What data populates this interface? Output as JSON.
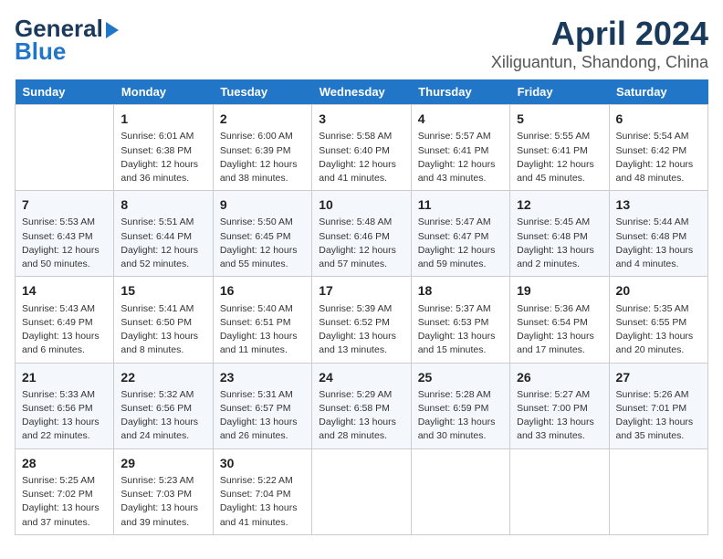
{
  "header": {
    "logo_line1": "General",
    "logo_line2": "Blue",
    "title": "April 2024",
    "subtitle": "Xiliguantun, Shandong, China"
  },
  "days_of_week": [
    "Sunday",
    "Monday",
    "Tuesday",
    "Wednesday",
    "Thursday",
    "Friday",
    "Saturday"
  ],
  "weeks": [
    [
      {
        "day": "",
        "content": ""
      },
      {
        "day": "1",
        "content": "Sunrise: 6:01 AM\nSunset: 6:38 PM\nDaylight: 12 hours\nand 36 minutes."
      },
      {
        "day": "2",
        "content": "Sunrise: 6:00 AM\nSunset: 6:39 PM\nDaylight: 12 hours\nand 38 minutes."
      },
      {
        "day": "3",
        "content": "Sunrise: 5:58 AM\nSunset: 6:40 PM\nDaylight: 12 hours\nand 41 minutes."
      },
      {
        "day": "4",
        "content": "Sunrise: 5:57 AM\nSunset: 6:41 PM\nDaylight: 12 hours\nand 43 minutes."
      },
      {
        "day": "5",
        "content": "Sunrise: 5:55 AM\nSunset: 6:41 PM\nDaylight: 12 hours\nand 45 minutes."
      },
      {
        "day": "6",
        "content": "Sunrise: 5:54 AM\nSunset: 6:42 PM\nDaylight: 12 hours\nand 48 minutes."
      }
    ],
    [
      {
        "day": "7",
        "content": "Sunrise: 5:53 AM\nSunset: 6:43 PM\nDaylight: 12 hours\nand 50 minutes."
      },
      {
        "day": "8",
        "content": "Sunrise: 5:51 AM\nSunset: 6:44 PM\nDaylight: 12 hours\nand 52 minutes."
      },
      {
        "day": "9",
        "content": "Sunrise: 5:50 AM\nSunset: 6:45 PM\nDaylight: 12 hours\nand 55 minutes."
      },
      {
        "day": "10",
        "content": "Sunrise: 5:48 AM\nSunset: 6:46 PM\nDaylight: 12 hours\nand 57 minutes."
      },
      {
        "day": "11",
        "content": "Sunrise: 5:47 AM\nSunset: 6:47 PM\nDaylight: 12 hours\nand 59 minutes."
      },
      {
        "day": "12",
        "content": "Sunrise: 5:45 AM\nSunset: 6:48 PM\nDaylight: 13 hours\nand 2 minutes."
      },
      {
        "day": "13",
        "content": "Sunrise: 5:44 AM\nSunset: 6:48 PM\nDaylight: 13 hours\nand 4 minutes."
      }
    ],
    [
      {
        "day": "14",
        "content": "Sunrise: 5:43 AM\nSunset: 6:49 PM\nDaylight: 13 hours\nand 6 minutes."
      },
      {
        "day": "15",
        "content": "Sunrise: 5:41 AM\nSunset: 6:50 PM\nDaylight: 13 hours\nand 8 minutes."
      },
      {
        "day": "16",
        "content": "Sunrise: 5:40 AM\nSunset: 6:51 PM\nDaylight: 13 hours\nand 11 minutes."
      },
      {
        "day": "17",
        "content": "Sunrise: 5:39 AM\nSunset: 6:52 PM\nDaylight: 13 hours\nand 13 minutes."
      },
      {
        "day": "18",
        "content": "Sunrise: 5:37 AM\nSunset: 6:53 PM\nDaylight: 13 hours\nand 15 minutes."
      },
      {
        "day": "19",
        "content": "Sunrise: 5:36 AM\nSunset: 6:54 PM\nDaylight: 13 hours\nand 17 minutes."
      },
      {
        "day": "20",
        "content": "Sunrise: 5:35 AM\nSunset: 6:55 PM\nDaylight: 13 hours\nand 20 minutes."
      }
    ],
    [
      {
        "day": "21",
        "content": "Sunrise: 5:33 AM\nSunset: 6:56 PM\nDaylight: 13 hours\nand 22 minutes."
      },
      {
        "day": "22",
        "content": "Sunrise: 5:32 AM\nSunset: 6:56 PM\nDaylight: 13 hours\nand 24 minutes."
      },
      {
        "day": "23",
        "content": "Sunrise: 5:31 AM\nSunset: 6:57 PM\nDaylight: 13 hours\nand 26 minutes."
      },
      {
        "day": "24",
        "content": "Sunrise: 5:29 AM\nSunset: 6:58 PM\nDaylight: 13 hours\nand 28 minutes."
      },
      {
        "day": "25",
        "content": "Sunrise: 5:28 AM\nSunset: 6:59 PM\nDaylight: 13 hours\nand 30 minutes."
      },
      {
        "day": "26",
        "content": "Sunrise: 5:27 AM\nSunset: 7:00 PM\nDaylight: 13 hours\nand 33 minutes."
      },
      {
        "day": "27",
        "content": "Sunrise: 5:26 AM\nSunset: 7:01 PM\nDaylight: 13 hours\nand 35 minutes."
      }
    ],
    [
      {
        "day": "28",
        "content": "Sunrise: 5:25 AM\nSunset: 7:02 PM\nDaylight: 13 hours\nand 37 minutes."
      },
      {
        "day": "29",
        "content": "Sunrise: 5:23 AM\nSunset: 7:03 PM\nDaylight: 13 hours\nand 39 minutes."
      },
      {
        "day": "30",
        "content": "Sunrise: 5:22 AM\nSunset: 7:04 PM\nDaylight: 13 hours\nand 41 minutes."
      },
      {
        "day": "",
        "content": ""
      },
      {
        "day": "",
        "content": ""
      },
      {
        "day": "",
        "content": ""
      },
      {
        "day": "",
        "content": ""
      }
    ]
  ]
}
